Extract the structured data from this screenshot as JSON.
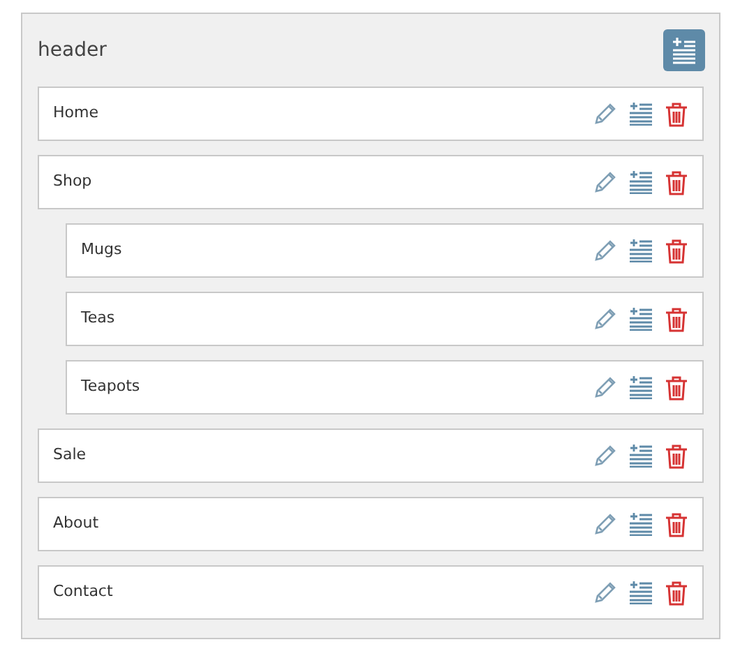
{
  "header": {
    "title": "header"
  },
  "items": [
    {
      "label": "Home"
    },
    {
      "label": "Shop",
      "children": [
        {
          "label": "Mugs"
        },
        {
          "label": "Teas"
        },
        {
          "label": "Teapots"
        }
      ]
    },
    {
      "label": "Sale"
    },
    {
      "label": "About"
    },
    {
      "label": "Contact"
    }
  ]
}
